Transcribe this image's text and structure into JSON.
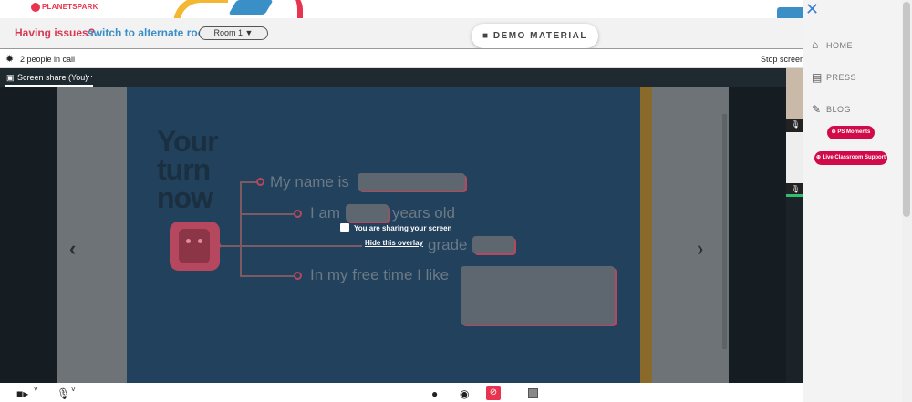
{
  "brand": {
    "logo_text": "PLANETSPARK"
  },
  "issues": {
    "prefix": "Having issues?",
    "link": "switch to alternate room",
    "room_selected": "Room 1"
  },
  "demo_material": "DEMO MATERIAL",
  "call": {
    "people_count": "2 people in call",
    "stop_label": "Stop screen"
  },
  "tab": {
    "label": "Screen share (You)",
    "more": "···"
  },
  "slide": {
    "heading_lines": [
      "Your",
      "turn",
      "now"
    ],
    "prompts": [
      "My name is",
      "I am",
      "years old",
      "grade",
      "In my free time I like"
    ]
  },
  "overlay": {
    "sharing": "You are sharing your screen",
    "hide": "Hide this overlay"
  },
  "nav": {
    "items": [
      {
        "label": "HOME",
        "icon": "home-icon"
      },
      {
        "label": "PRESS",
        "icon": "newspaper-icon"
      },
      {
        "label": "BLOG",
        "icon": "pencil-icon"
      }
    ],
    "ps_moments": "PS Moments",
    "live_support": "Live Classroom Support"
  },
  "colors": {
    "accent": "#d10a4a",
    "brand_red": "#e8344e",
    "brand_blue": "#3a8fc7",
    "slide_bg": "#22415c"
  }
}
